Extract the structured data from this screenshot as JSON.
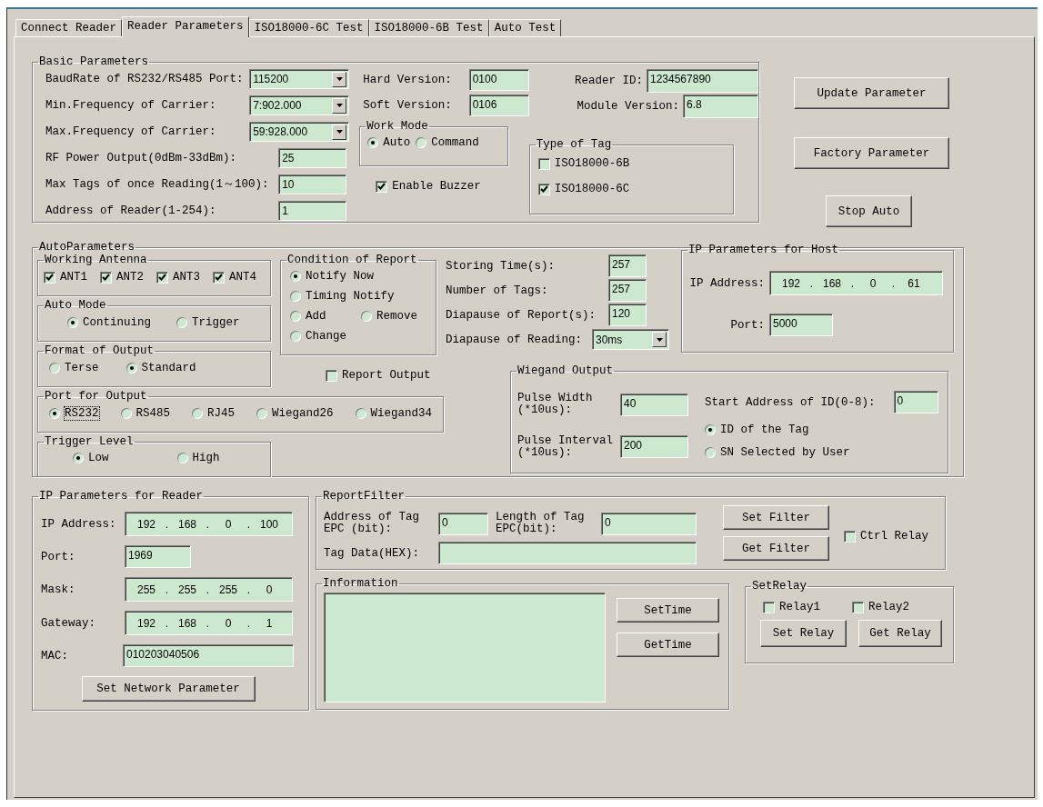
{
  "tabs": [
    {
      "label": "Connect Reader",
      "selected": false
    },
    {
      "label": "Reader Parameters",
      "selected": true
    },
    {
      "label": "ISO18000-6C Test",
      "selected": false
    },
    {
      "label": "ISO18000-6B Test",
      "selected": false
    },
    {
      "label": "Auto Test",
      "selected": false
    }
  ],
  "basic_parameters": {
    "title": "Basic Parameters",
    "settings": [
      {
        "label": "BaudRate of RS232/RS485 Port:",
        "value": "115200",
        "kind": "dropdown"
      },
      {
        "label": "Min.Frequency of Carrier:",
        "value": "7:902.000",
        "kind": "dropdown"
      },
      {
        "label": "Max.Frequency of Carrier:",
        "value": "59:928.000",
        "kind": "dropdown"
      },
      {
        "label": "RF Power Output(0dBm-33dBm):",
        "value": "25",
        "kind": "text"
      },
      {
        "label": "Max Tags of once Reading(1～100):",
        "value": "10",
        "kind": "text"
      },
      {
        "label": "Address of Reader(1-254):",
        "value": "1",
        "kind": "text"
      }
    ],
    "versions": [
      {
        "label": "Hard Version:",
        "value": "0100"
      },
      {
        "label": "Soft Version:",
        "value": "0106"
      }
    ],
    "work_mode": {
      "title": "Work Mode",
      "options": [
        {
          "label": "Auto",
          "selected": true
        },
        {
          "label": "Command",
          "selected": false
        }
      ]
    },
    "enable_buzzer": {
      "label": "Enable Buzzer",
      "checked": true
    },
    "reader_info": [
      {
        "label": "Reader ID:",
        "value": "1234567890"
      },
      {
        "label": "Module Version:",
        "value": "6.8"
      }
    ],
    "type_of_tag": {
      "title": "Type of Tag",
      "options": [
        {
          "label": "ISO18000-6B",
          "checked": false
        },
        {
          "label": "ISO18000-6C",
          "checked": true
        }
      ]
    }
  },
  "actions": [
    "Update Parameter",
    "Factory Parameter",
    "Stop Auto"
  ],
  "auto_parameters": {
    "title": "AutoParameters",
    "working_antenna": {
      "title": "Working Antenna",
      "antennas": [
        {
          "label": "ANT1",
          "checked": true
        },
        {
          "label": "ANT2",
          "checked": true
        },
        {
          "label": "ANT3",
          "checked": true
        },
        {
          "label": "ANT4",
          "checked": true
        }
      ]
    },
    "auto_mode": {
      "title": "Auto Mode",
      "options": [
        {
          "label": "Continuing",
          "selected": true
        },
        {
          "label": "Trigger",
          "selected": false
        }
      ]
    },
    "format_of_output": {
      "title": "Format of Output",
      "options": [
        {
          "label": "Terse",
          "selected": false
        },
        {
          "label": "Standard",
          "selected": true
        }
      ]
    },
    "port_for_output": {
      "title": "Port for Output",
      "options": [
        {
          "label": "RS232",
          "selected": true,
          "focused": true
        },
        {
          "label": "RS485",
          "selected": false,
          "focused": false
        },
        {
          "label": "RJ45",
          "selected": false,
          "focused": false
        },
        {
          "label": "Wiegand26",
          "selected": false,
          "focused": false
        },
        {
          "label": "Wiegand34",
          "selected": false,
          "focused": false
        }
      ]
    },
    "trigger_level": {
      "title": "Trigger Level",
      "options": [
        {
          "label": "Low",
          "selected": true
        },
        {
          "label": "High",
          "selected": false
        }
      ]
    },
    "condition_of_report": {
      "title": "Condition of Report",
      "options": [
        {
          "label": "Notify Now",
          "selected": true
        },
        {
          "label": "Timing Notify",
          "selected": false
        },
        {
          "label": "Add",
          "selected": false
        },
        {
          "label": "Remove",
          "selected": false
        },
        {
          "label": "Change",
          "selected": false
        }
      ]
    },
    "report_output": {
      "label": "Report Output",
      "checked": false
    },
    "timing": [
      {
        "label": "Storing Time(s):",
        "value": "257",
        "kind": "text"
      },
      {
        "label": "Number of Tags:",
        "value": "257",
        "kind": "text"
      },
      {
        "label": "Diapause of Report(s):",
        "value": "120",
        "kind": "text"
      },
      {
        "label": "Diapause of Reading:",
        "value": "30ms",
        "kind": "dropdown"
      }
    ],
    "ip_parameters_for_host": {
      "title": "IP Parameters for Host",
      "ip_address": {
        "label": "IP Address:",
        "octets": [
          "192",
          "168",
          "0",
          "61"
        ],
        "separator": "."
      },
      "port": {
        "label": "Port:",
        "value": "5000"
      }
    },
    "wiegand_output": {
      "title": "Wiegand Output",
      "pulse_width": {
        "label": "Pulse Width (*10us):",
        "value": "40"
      },
      "pulse_interval": {
        "label": "Pulse Interval (*10us):",
        "value": "200"
      },
      "start_address": {
        "label": "Start Address of ID(0-8):",
        "value": "0"
      },
      "id_source": [
        {
          "label": "ID of the Tag",
          "selected": true
        },
        {
          "label": "SN Selected by User",
          "selected": false
        }
      ]
    }
  },
  "ip_parameters_for_reader": {
    "title": "IP Parameters for Reader",
    "fields": [
      {
        "label": "IP Address:",
        "kind": "ip",
        "octets": [
          "192",
          "168",
          "0",
          "100"
        ],
        "separator": "."
      },
      {
        "label": "Port:",
        "kind": "text",
        "value": "1969"
      },
      {
        "label": "Mask:",
        "kind": "ip",
        "octets": [
          "255",
          "255",
          "255",
          "0"
        ],
        "separator": "."
      },
      {
        "label": "Gateway:",
        "kind": "ip",
        "octets": [
          "192",
          "168",
          "0",
          "1"
        ],
        "separator": "."
      },
      {
        "label": "MAC:",
        "kind": "text",
        "value": "010203040506"
      }
    ],
    "button": "Set Network Parameter"
  },
  "report_filter": {
    "title": "ReportFilter",
    "address": {
      "label": "Address of Tag EPC (bit):",
      "value": "0"
    },
    "length": {
      "label": "Length of Tag EPC(bit):",
      "value": "0"
    },
    "tag_data": {
      "label": "Tag Data(HEX):"
    },
    "buttons": [
      "Set Filter",
      "Get Filter"
    ],
    "ctrl_relay": {
      "label": "Ctrl Relay",
      "checked": false
    }
  },
  "information": {
    "title": "Information",
    "buttons": [
      "SetTime",
      "GetTime"
    ]
  },
  "set_relay": {
    "title": "SetRelay",
    "relays": [
      {
        "label": "Relay1",
        "checked": false
      },
      {
        "label": "Relay2",
        "checked": false
      }
    ],
    "buttons": [
      "Set Relay",
      "Get Relay"
    ]
  }
}
